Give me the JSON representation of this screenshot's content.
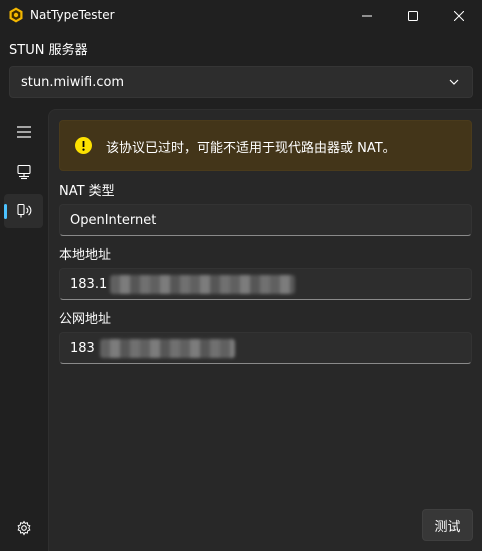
{
  "window": {
    "title": "NatTypeTester"
  },
  "stun": {
    "label": "STUN 服务器",
    "value": "stun.miwifi.com"
  },
  "nav": {
    "items": [
      {
        "icon": "hamburger-menu-icon"
      },
      {
        "icon": "desktop-pc-icon"
      },
      {
        "icon": "nat-test-icon",
        "selected": true
      },
      {
        "icon": "settings-gear-icon"
      }
    ],
    "accent": "#4cc2ff"
  },
  "warning": {
    "text": "该协议已过时，可能不适用于现代路由器或 NAT。",
    "icon": "warning-exclamation-icon",
    "color": "#fce100"
  },
  "fields": {
    "nat_type": {
      "label": "NAT 类型",
      "value": "OpenInternet"
    },
    "local_address": {
      "label": "本地地址",
      "value": "183.1"
    },
    "public_address": {
      "label": "公网地址",
      "value": "183"
    }
  },
  "actions": {
    "test_label": "测试"
  }
}
